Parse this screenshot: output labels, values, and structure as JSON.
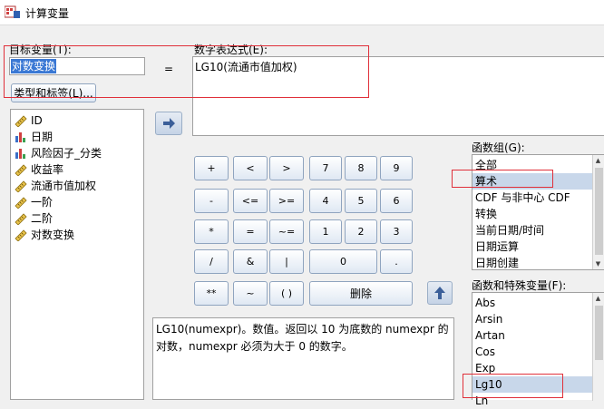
{
  "window": {
    "title": "计算变量"
  },
  "target": {
    "label": "目标变量(T):",
    "value": "对数变换",
    "type_label_button": "类型和标签(L)..."
  },
  "equals_sign": "=",
  "expression": {
    "label": "数字表达式(E):",
    "value": "LG10(流通市值加权)"
  },
  "variables": [
    {
      "name": "ID",
      "icon": "ruler-icon"
    },
    {
      "name": "日期",
      "icon": "bar-chart-icon"
    },
    {
      "name": "风险因子_分类",
      "icon": "bar-chart-icon"
    },
    {
      "name": "收益率",
      "icon": "ruler-icon"
    },
    {
      "name": "流通市值加权",
      "icon": "ruler-icon"
    },
    {
      "name": "一阶",
      "icon": "ruler-icon"
    },
    {
      "name": "二阶",
      "icon": "ruler-icon"
    },
    {
      "name": "对数变换",
      "icon": "ruler-icon"
    }
  ],
  "keypad": {
    "plus": "+",
    "lt": "<",
    "gt": ">",
    "k7": "7",
    "k8": "8",
    "k9": "9",
    "minus": "-",
    "le": "<=",
    "ge": ">=",
    "k4": "4",
    "k5": "5",
    "k6": "6",
    "mul": "*",
    "eq": "=",
    "ne": "~=",
    "k1": "1",
    "k2": "2",
    "k3": "3",
    "div": "/",
    "and": "&",
    "or": "|",
    "k0": "0",
    "dot": ".",
    "pow": "**",
    "not": "~",
    "parens": "( )",
    "delete": "删除"
  },
  "description": "LG10(numexpr)。数值。返回以 10 为底数的 numexpr 的对数，numexpr 必须为大于 0 的数字。",
  "function_group": {
    "label": "函数组(G):",
    "items": [
      "全部",
      "算术",
      "CDF 与非中心 CDF",
      "转换",
      "当前日期/时间",
      "日期运算",
      "日期创建"
    ],
    "selected": "算术"
  },
  "function_list": {
    "label": "函数和特殊变量(F):",
    "items": [
      "Abs",
      "Arsin",
      "Artan",
      "Cos",
      "Exp",
      "Lg10",
      "Ln"
    ],
    "selected": "Lg10"
  },
  "colors": {
    "selection": "#c8d7ea",
    "highlight_box": "#e0303a",
    "button_border": "#8fa4bf"
  }
}
